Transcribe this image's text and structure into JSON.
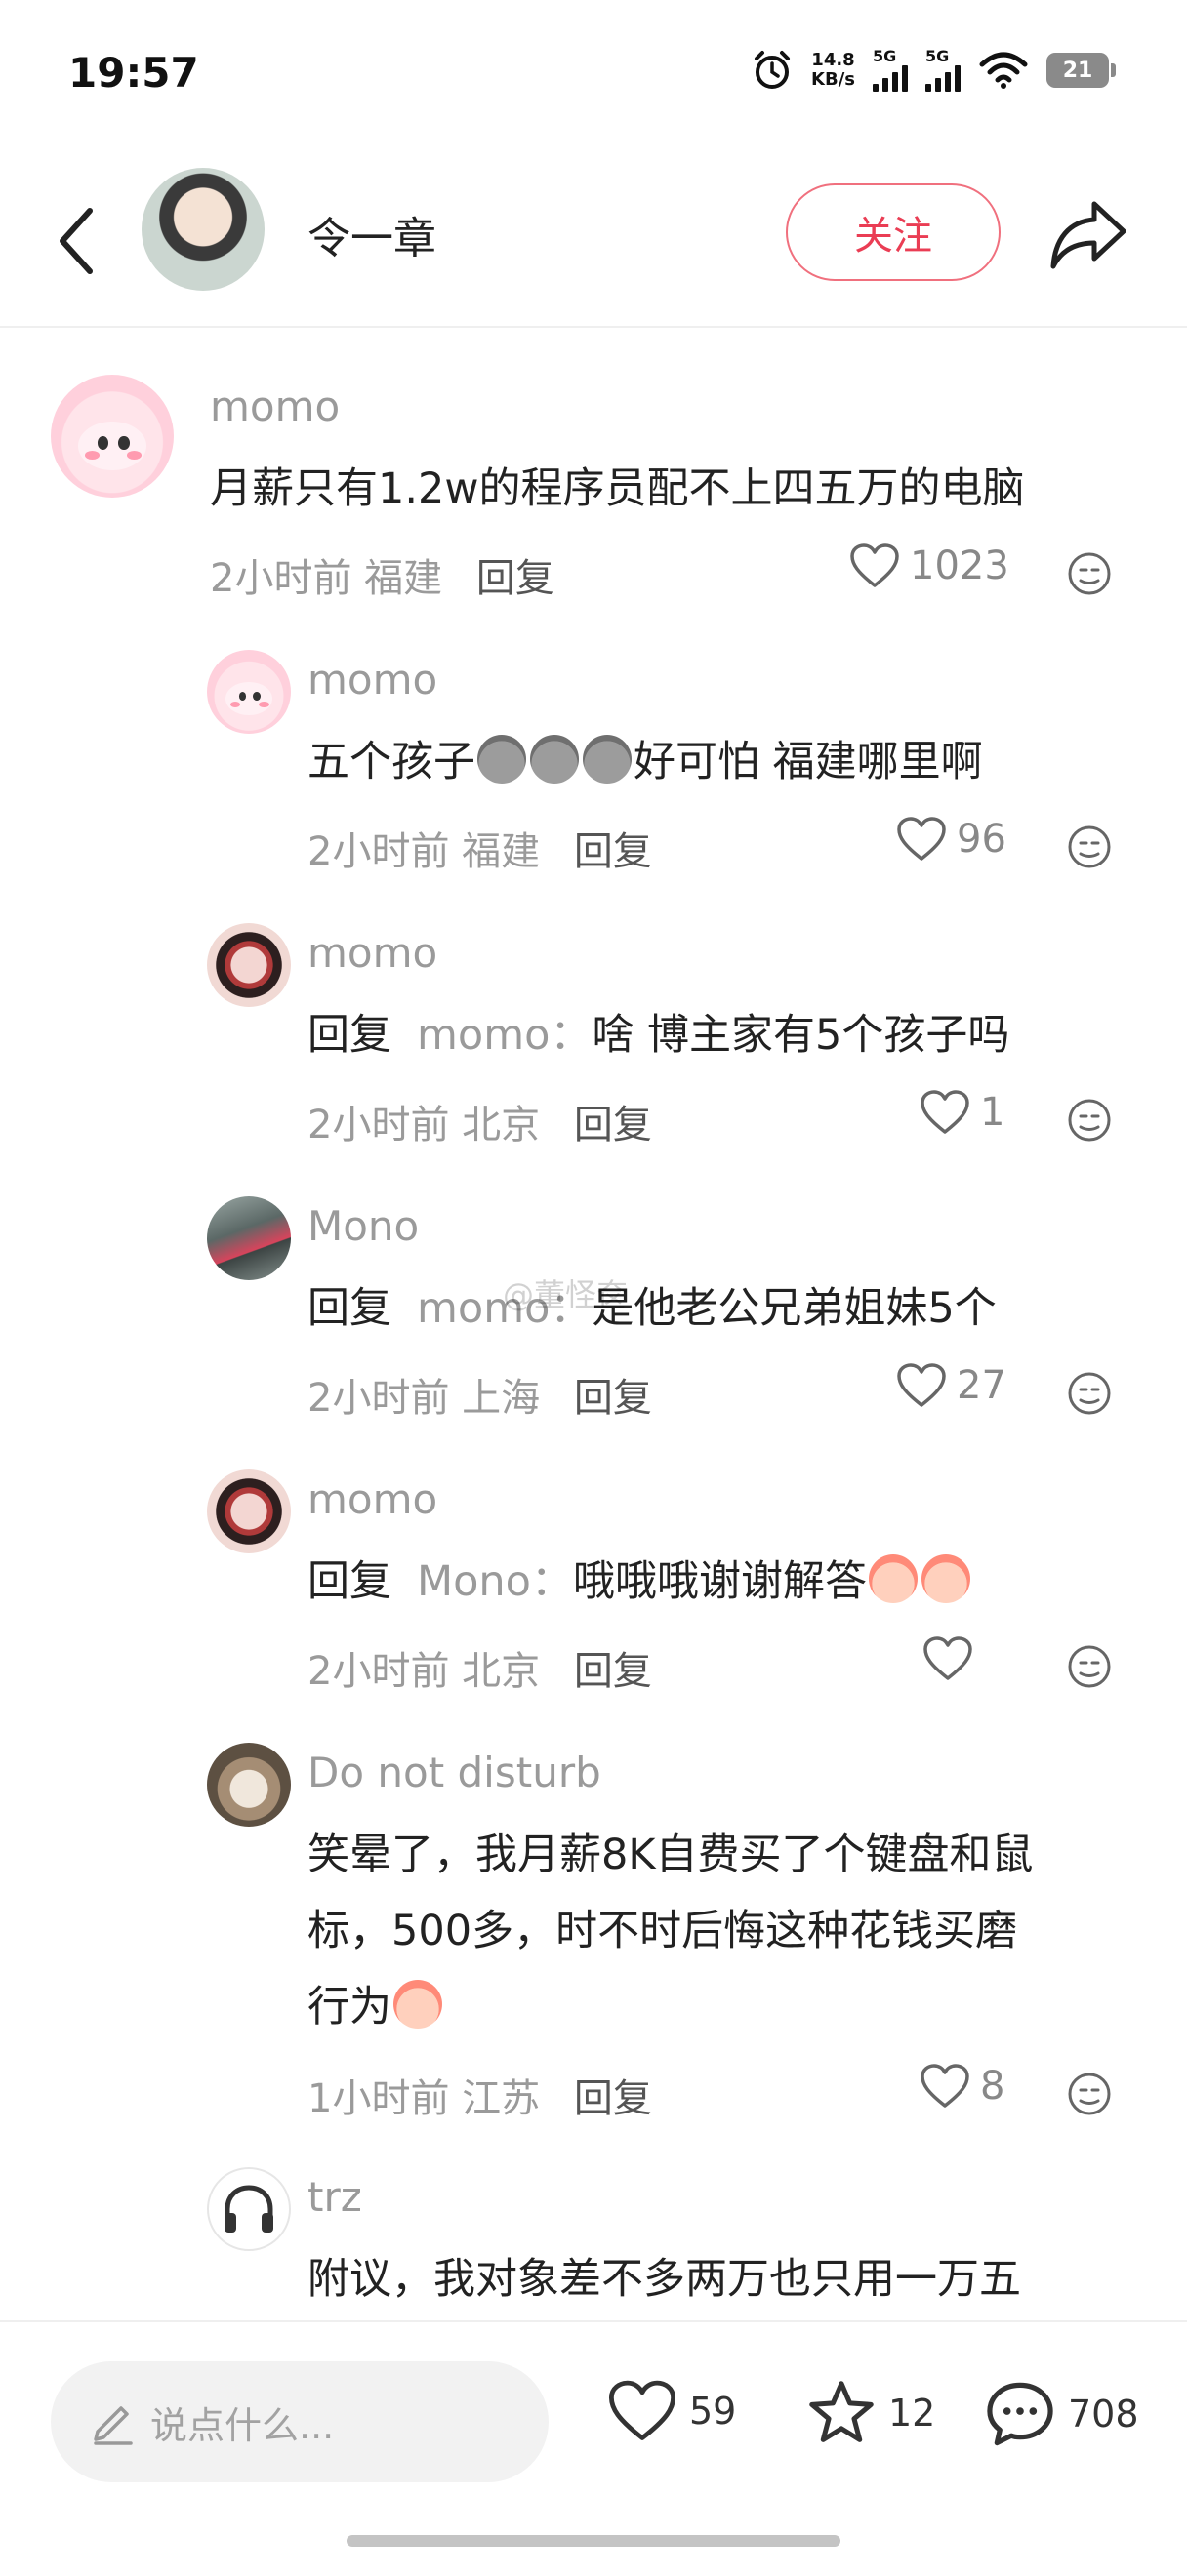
{
  "status_bar": {
    "time": "19:57",
    "net_speed_value": "14.8",
    "net_speed_unit": "KB/s",
    "signal1_label": "5G",
    "signal2_label": "5G",
    "battery_level": "21"
  },
  "header": {
    "author_name": "令一章",
    "follow_label": "关注"
  },
  "comments": [
    {
      "username": "momo",
      "text": "月薪只有1.2w的程序员配不上四五万的电脑",
      "time": "2小时前",
      "location": "福建",
      "reply_label": "回复",
      "likes": "1023"
    },
    {
      "username": "momo",
      "text_before": "五个孩子",
      "text_after": "好可怕 福建哪里啊",
      "time": "2小时前",
      "location": "福建",
      "reply_label": "回复",
      "likes": "96"
    },
    {
      "username": "momo",
      "reply_prefix": "回复",
      "reply_target": "momo：",
      "text": "啥 博主家有5个孩子吗",
      "time": "2小时前",
      "location": "北京",
      "reply_label": "回复",
      "likes": "1"
    },
    {
      "username": "Mono",
      "reply_prefix": "回复",
      "reply_target": "momo：",
      "text": "是他老公兄弟姐妹5个",
      "time": "2小时前",
      "location": "上海",
      "reply_label": "回复",
      "likes": "27"
    },
    {
      "username": "momo",
      "reply_prefix": "回复",
      "reply_target": "Mono：",
      "text": "哦哦哦谢谢解答",
      "time": "2小时前",
      "location": "北京",
      "reply_label": "回复",
      "likes": ""
    },
    {
      "username": "Do not disturb",
      "text_line1": "笑晕了，我月薪8K自费买了个键盘和鼠",
      "text_line2": "标，500多，时不时后悔这种花钱买磨",
      "text_line3": "行为",
      "time": "1小时前",
      "location": "江苏",
      "reply_label": "回复",
      "likes": "8"
    },
    {
      "username": "trz",
      "text": "附议，我对象差不多两万也只用一万五"
    }
  ],
  "watermark": "@董怪奁",
  "bottom_bar": {
    "input_placeholder": "说点什么...",
    "likes": "59",
    "favorites": "12",
    "comments": "708"
  },
  "icons": [
    "back-icon",
    "share-icon",
    "heart-icon",
    "emoji-icon",
    "pencil-icon",
    "star-icon",
    "comment-bubble-icon",
    "alarm-icon",
    "wifi-icon"
  ]
}
